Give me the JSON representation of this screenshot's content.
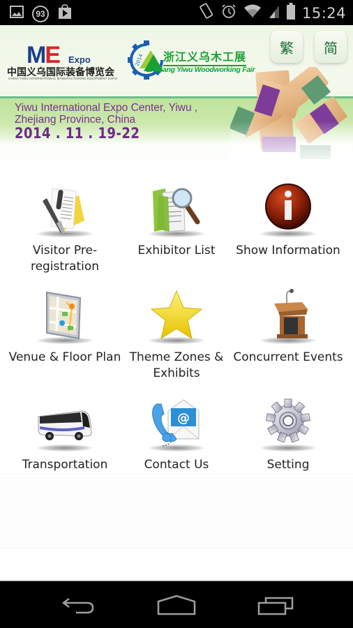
{
  "status_bar": {
    "notification_icons": [
      "gallery-icon",
      "badge-93",
      "play-store-icon"
    ],
    "badge_count": "93",
    "system_icons": [
      "vibrate-icon",
      "alarm-icon",
      "wifi-icon",
      "cell-signal-icon",
      "battery-icon"
    ],
    "time": "15:24"
  },
  "banner": {
    "me_logo": {
      "letters_m": "M",
      "letters_e": "E",
      "expo": "Expo",
      "chinese": "中国义乌国际装备博览会",
      "english": "CHINA YIWU INTERNATIONAL MANUFACTURING EQUIPMENT EXPO"
    },
    "wood_logo": {
      "year": "2014",
      "chinese": "浙江义乌木工展",
      "english": "Zhejiang Yiwu Woodworking Fair"
    },
    "lang_buttons": {
      "traditional": "繁",
      "simplified": "简"
    },
    "venue_line1": "Yiwu International Expo Center, Yiwu ,",
    "venue_line2": "Zhejiang Province, China",
    "date": "2014 . 11 . 19-22"
  },
  "menu": {
    "items": [
      {
        "label": "Visitor Pre-registration",
        "icon": "document-pen-icon"
      },
      {
        "label": "Exhibitor List",
        "icon": "folder-magnifier-icon"
      },
      {
        "label": "Show Information",
        "icon": "info-icon"
      },
      {
        "label": "Venue & Floor Plan",
        "icon": "map-icon"
      },
      {
        "label": "Theme Zones & Exhibits",
        "icon": "star-icon"
      },
      {
        "label": "Concurrent Events",
        "icon": "podium-icon"
      },
      {
        "label": "Transportation",
        "icon": "bus-icon"
      },
      {
        "label": "Contact Us",
        "icon": "phone-mail-icon"
      },
      {
        "label": "Setting",
        "icon": "gear-icon"
      }
    ]
  },
  "nav_bar": {
    "buttons": [
      "back",
      "home",
      "recent-apps"
    ]
  },
  "colors": {
    "accent_purple": "#7a2e8e",
    "band_green": "#c6e7a6",
    "logo_green": "#1aa036",
    "logo_blue": "#1d3f8a",
    "logo_red": "#d6262a"
  }
}
